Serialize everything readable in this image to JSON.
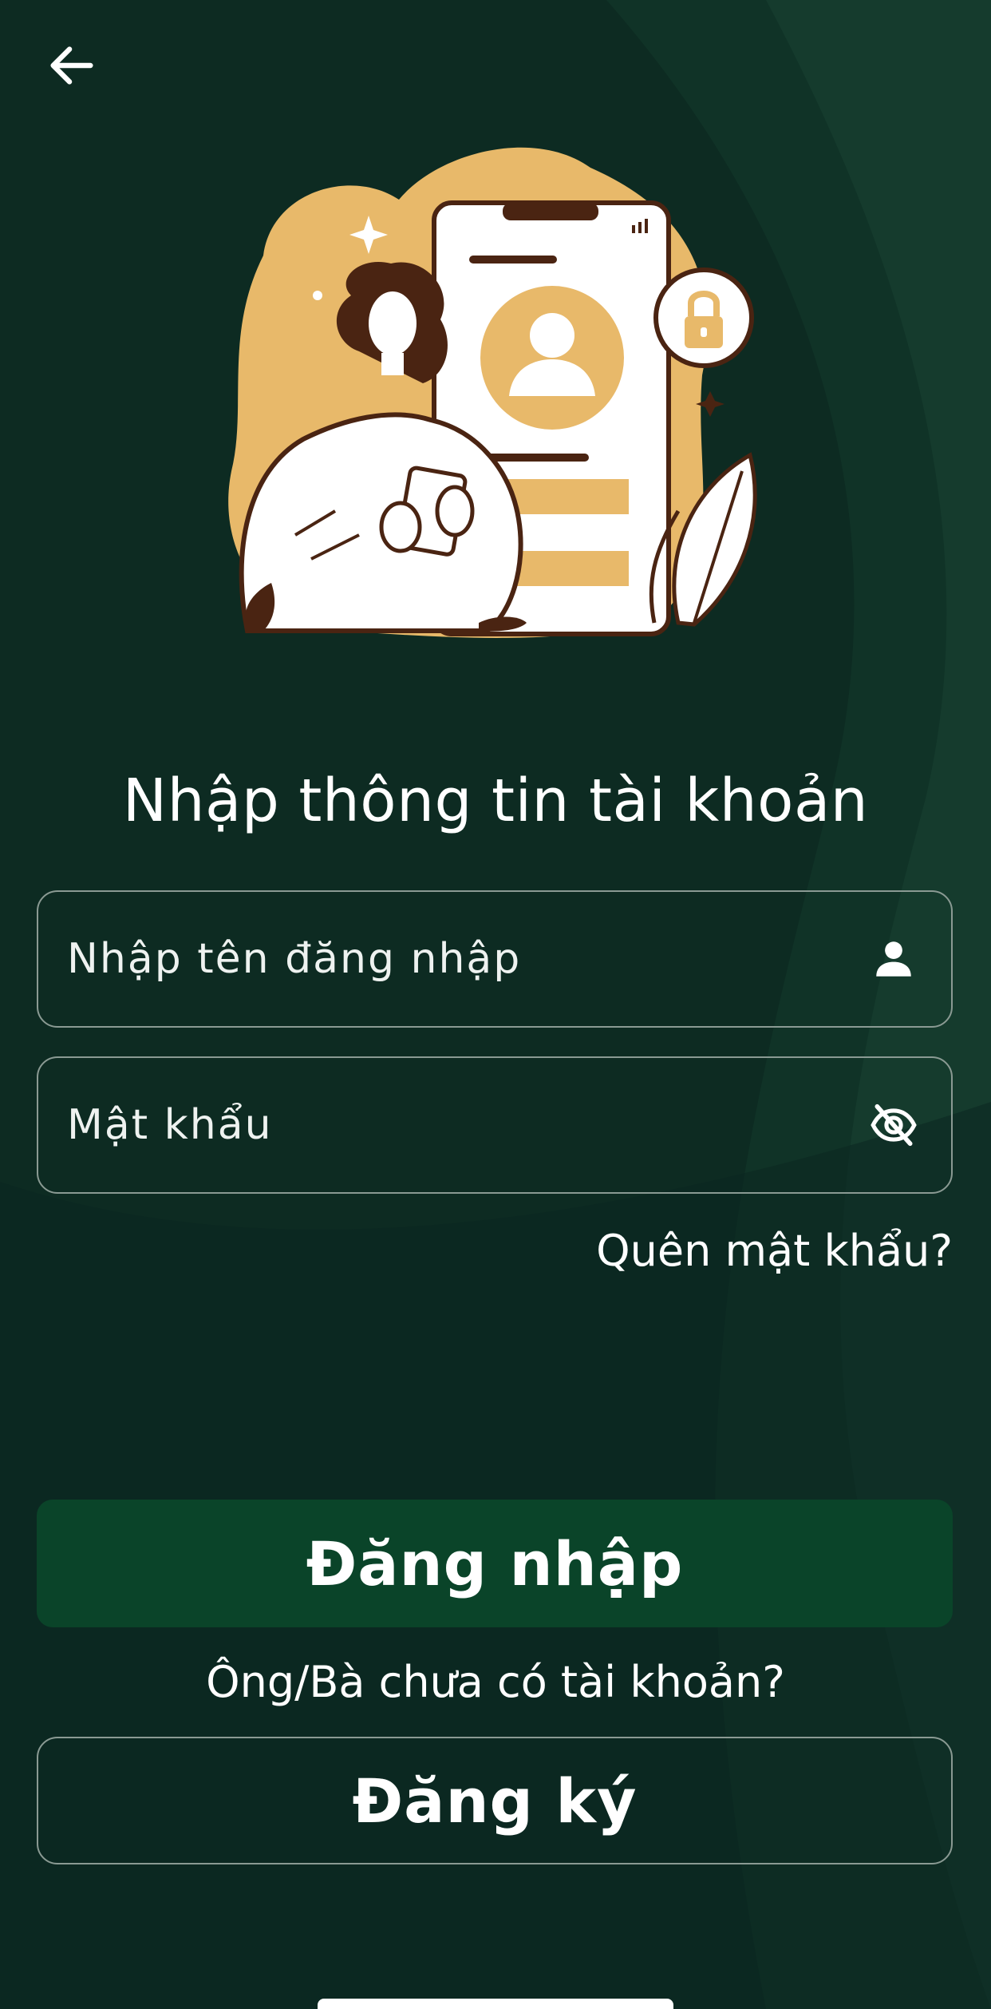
{
  "header": {
    "back_icon": "arrow-left-icon"
  },
  "hero": {
    "illustration": "woman-with-phone-login-illustration"
  },
  "form": {
    "title": "Nhập thông tin tài khoản",
    "username": {
      "placeholder": "Nhập tên đăng nhập",
      "value": "",
      "icon": "person-icon"
    },
    "password": {
      "placeholder": "Mật khẩu",
      "value": "",
      "icon": "eye-off-icon"
    },
    "forgot_label": "Quên mật khẩu?"
  },
  "actions": {
    "login_label": "Đăng nhập",
    "no_account_text": "Ông/Bà chưa có tài khoản?",
    "register_label": "Đăng ký"
  },
  "colors": {
    "background": "#0d2b22",
    "primary_button": "#0a4429",
    "illustration_gold": "#e8b96a",
    "illustration_brown": "#4a2412",
    "border": "#8a9a93"
  }
}
